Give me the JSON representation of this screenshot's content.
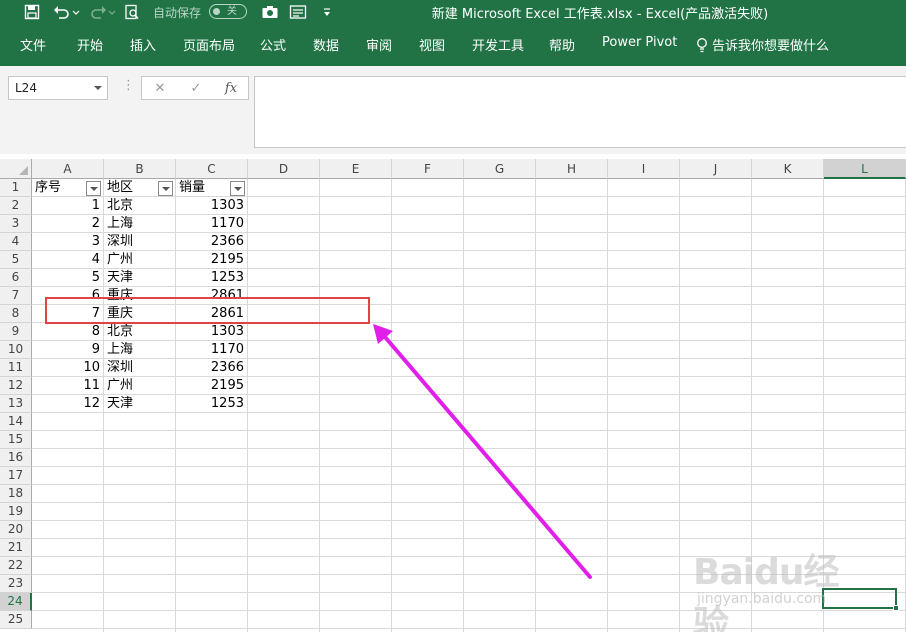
{
  "window": {
    "title": "新建 Microsoft Excel 工作表.xlsx  -  Excel(产品激活失败)",
    "autosave_label": "自动保存",
    "autosave_state": "关"
  },
  "ribbon": {
    "tabs": [
      "文件",
      "开始",
      "插入",
      "页面布局",
      "公式",
      "数据",
      "审阅",
      "视图",
      "开发工具",
      "帮助",
      "Power Pivot"
    ],
    "tell_me": "告诉我你想要做什么"
  },
  "formula_bar": {
    "name_box": "L24",
    "fx_label": "fx",
    "formula_value": ""
  },
  "grid": {
    "columns": [
      "A",
      "B",
      "C",
      "D",
      "E",
      "F",
      "G",
      "H",
      "I",
      "J",
      "K",
      "L"
    ],
    "rows": [
      "1",
      "2",
      "3",
      "4",
      "5",
      "6",
      "7",
      "8",
      "9",
      "10",
      "11",
      "12",
      "13",
      "14",
      "15",
      "16",
      "17",
      "18",
      "19",
      "20",
      "21",
      "22",
      "23",
      "24",
      "25"
    ],
    "selected_column": "L",
    "selected_row": "24"
  },
  "table": {
    "headers": [
      "序号",
      "地区",
      "销量"
    ],
    "rows": [
      [
        "1",
        "北京",
        "1303"
      ],
      [
        "2",
        "上海",
        "1170"
      ],
      [
        "3",
        "深圳",
        "2366"
      ],
      [
        "4",
        "广州",
        "2195"
      ],
      [
        "5",
        "天津",
        "1253"
      ],
      [
        "6",
        "重庆",
        "2861"
      ],
      [
        "7",
        "重庆",
        "2861"
      ],
      [
        "8",
        "北京",
        "1303"
      ],
      [
        "9",
        "上海",
        "1170"
      ],
      [
        "10",
        "深圳",
        "2366"
      ],
      [
        "11",
        "广州",
        "2195"
      ],
      [
        "12",
        "天津",
        "1253"
      ]
    ]
  },
  "watermark": {
    "logo": "Baidu经验",
    "url": "jingyan.baidu.com"
  },
  "colors": {
    "excel_green": "#217346",
    "highlight_red": "#e04343",
    "arrow_magenta": "#e020e8"
  }
}
